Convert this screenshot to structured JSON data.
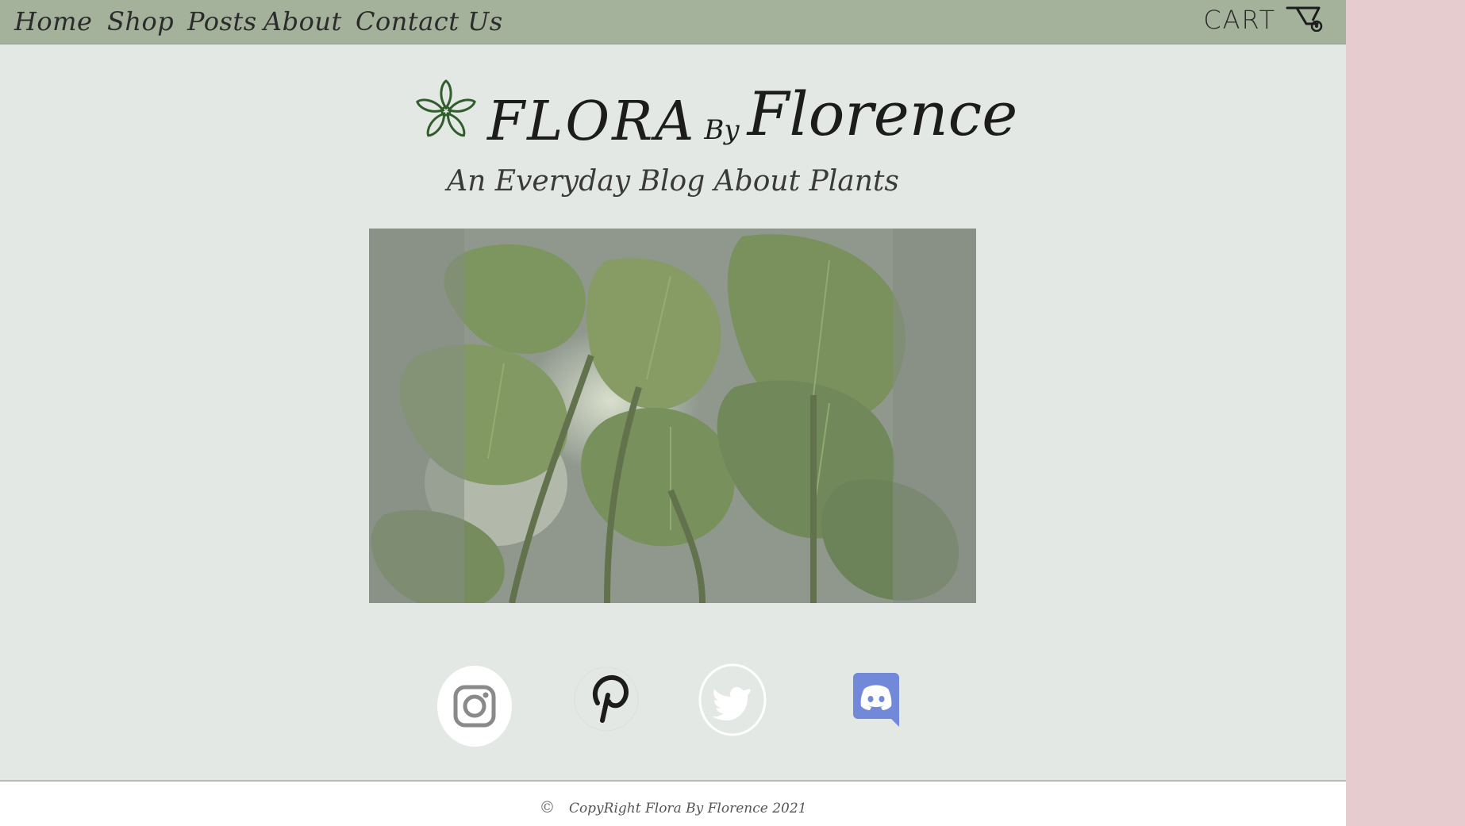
{
  "nav": {
    "items": [
      {
        "label": "Home"
      },
      {
        "label": "Shop"
      },
      {
        "label": "Posts"
      },
      {
        "label": "About"
      },
      {
        "label": "Contact Us"
      }
    ],
    "cart_label": "CART"
  },
  "logo": {
    "flora": "FLORA",
    "by": "By",
    "florence": "Florence"
  },
  "tagline": "An Everyday Blog About Plants",
  "hero": {
    "icon": "tropical-leaves-image"
  },
  "socials": [
    {
      "name": "instagram-icon"
    },
    {
      "name": "pinterest-icon"
    },
    {
      "name": "twitter-icon"
    },
    {
      "name": "discord-icon"
    }
  ],
  "footer": {
    "symbol": "©",
    "copyright": "CopyRight Flora By Florence 2021"
  },
  "colors": {
    "nav_bg": "#a4b29c",
    "page_bg": "#e4e8e4",
    "side_bg": "#e6cbcf",
    "discord": "#7289da"
  }
}
